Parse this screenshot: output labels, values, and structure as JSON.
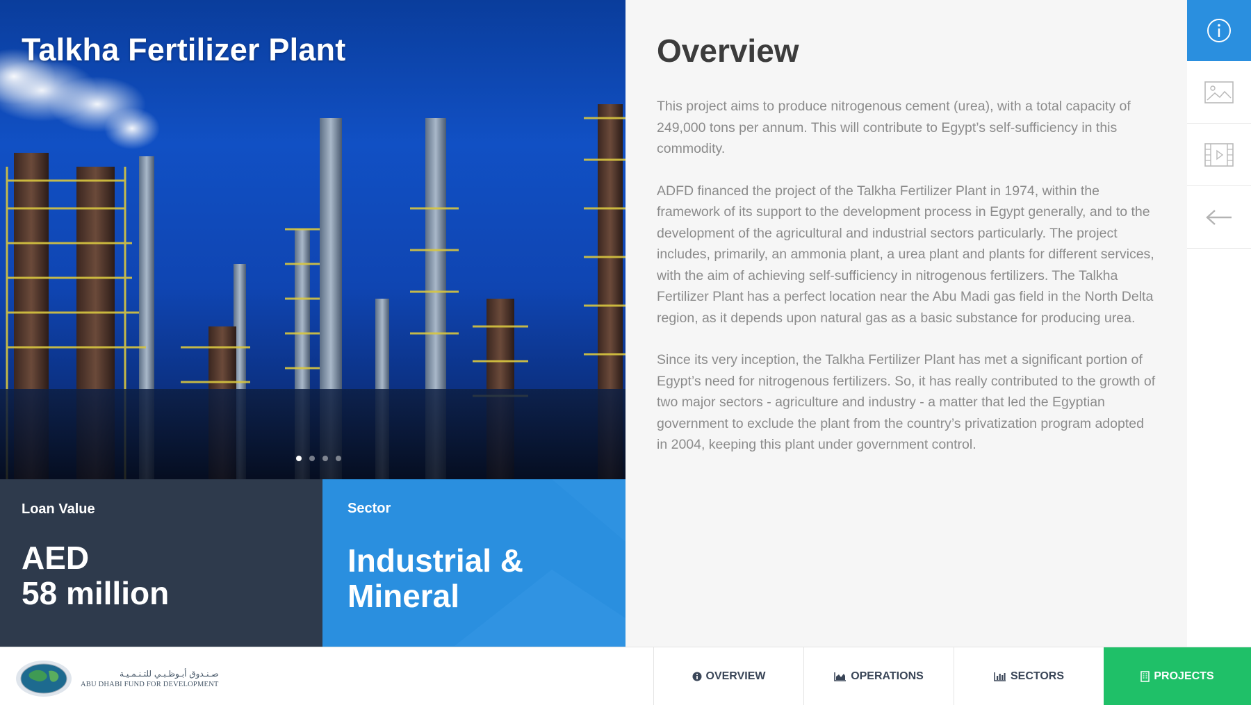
{
  "project": {
    "title": "Talkha Fertilizer Plant"
  },
  "carousel": {
    "slides": 4,
    "active_index": 0
  },
  "loan": {
    "label": "Loan Value",
    "value_line1": "AED",
    "value_line2": "58 million"
  },
  "sector": {
    "label": "Sector",
    "value_line1": "Industrial &",
    "value_line2": "Mineral"
  },
  "overview": {
    "title": "Overview",
    "paragraphs": [
      "This project aims to produce nitrogenous cement (urea), with a total capacity of 249,000 tons per annum. This will contribute to Egypt’s self-sufficiency in this commodity.",
      "ADFD financed the project of the Talkha Fertilizer Plant in 1974, within the framework of its support to the development process in Egypt generally, and to the development of the agricultural and industrial sectors particularly. The project includes, primarily, an ammonia plant, a urea plant and plants for different services, with the aim of achieving self-sufficiency in nitrogenous fertilizers. The Talkha Fertilizer Plant has a perfect location near the Abu Madi gas field in the North Delta region, as it depends upon natural gas as a basic substance for producing urea.",
      "Since its very inception, the Talkha Fertilizer Plant has met a significant portion of Egypt’s need for nitrogenous fertilizers. So, it has really contributed to the growth of two major sectors - agriculture and industry - a matter that led the Egyptian government to exclude the plant from the country’s privatization program adopted in 2004, keeping this plant under government control."
    ]
  },
  "sidebar": {
    "buttons": [
      {
        "icon": "info-icon",
        "active": true
      },
      {
        "icon": "image-icon",
        "active": false
      },
      {
        "icon": "video-icon",
        "active": false
      },
      {
        "icon": "back-arrow-icon",
        "active": false
      }
    ]
  },
  "logo": {
    "arabic": "صـنـدوق أبـوظـبـي للتـنـمـيـة",
    "english": "ABU DHABI FUND FOR DEVELOPMENT"
  },
  "nav": {
    "overview": "OVERVIEW",
    "operations": "OPERATIONS",
    "sectors": "SECTORS",
    "projects": "PROJECTS",
    "active": "projects"
  },
  "colors": {
    "accent_blue": "#2a8fdf",
    "dark_tile": "#2e3a4c",
    "active_green": "#1fc068",
    "body_text": "#8b8b8b"
  }
}
